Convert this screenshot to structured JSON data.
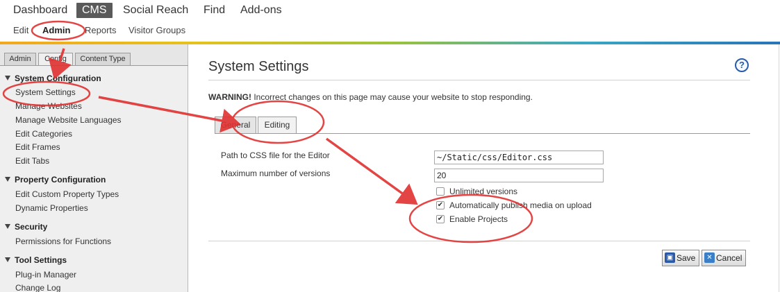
{
  "topnav": {
    "items": [
      "Dashboard",
      "CMS",
      "Social Reach",
      "Find",
      "Add-ons"
    ],
    "active": "CMS"
  },
  "subnav": {
    "items": [
      "Edit",
      "Admin",
      "Reports",
      "Visitor Groups"
    ],
    "active": "Admin"
  },
  "left_tabs": [
    "Admin",
    "Config",
    "Content Type"
  ],
  "left_tabs_active": "Config",
  "sidebar": {
    "sections": [
      {
        "title": "System Configuration",
        "links": [
          "System Settings",
          "Manage Websites",
          "Manage Website Languages",
          "Edit Categories",
          "Edit Frames",
          "Edit Tabs"
        ]
      },
      {
        "title": "Property Configuration",
        "links": [
          "Edit Custom Property Types",
          "Dynamic Properties"
        ]
      },
      {
        "title": "Security",
        "links": [
          "Permissions for Functions"
        ]
      },
      {
        "title": "Tool Settings",
        "links": [
          "Plug-in Manager",
          "Change Log"
        ]
      }
    ]
  },
  "page": {
    "title": "System Settings",
    "help_icon": "?",
    "warning_strong": "WARNING!",
    "warning_text": "Incorrect changes on this page may cause your website to stop responding.",
    "tabs": [
      "General",
      "Editing"
    ],
    "active_tab": "Editing"
  },
  "form": {
    "css_path_label": "Path to CSS file for the Editor",
    "css_path_value": "~/Static/css/Editor.css",
    "max_versions_label": "Maximum number of versions",
    "max_versions_value": "20",
    "checkboxes": [
      {
        "label": "Unlimited versions",
        "checked": false
      },
      {
        "label": "Automatically publish media on upload",
        "checked": true
      },
      {
        "label": "Enable Projects",
        "checked": true
      }
    ]
  },
  "buttons": {
    "save": "Save",
    "cancel": "Cancel"
  },
  "colors": {
    "annotation": "#e03030",
    "accent_blue": "#2a5aa8"
  }
}
